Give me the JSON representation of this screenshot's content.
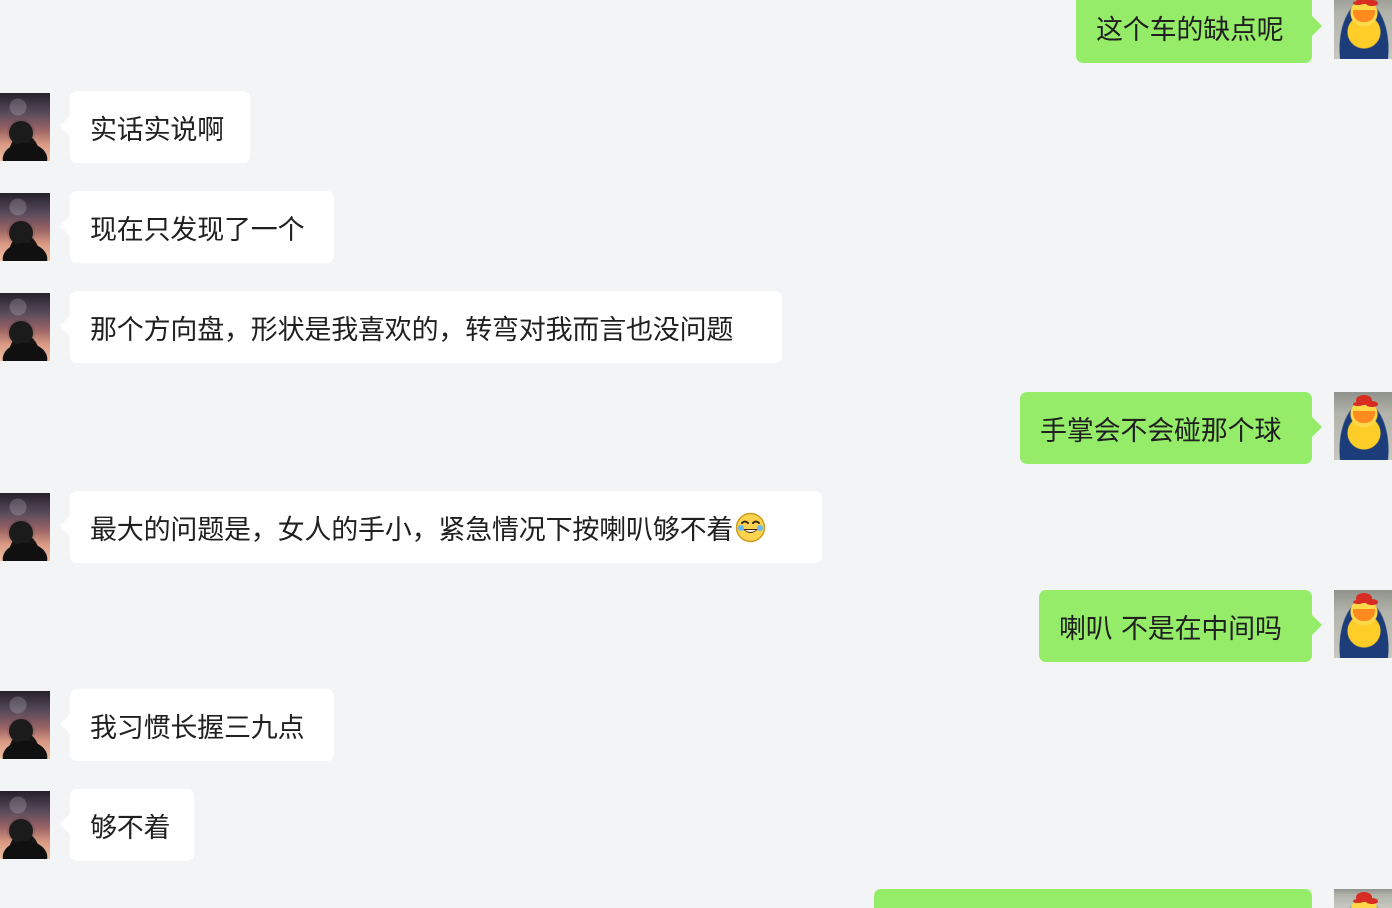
{
  "messages": [
    {
      "side": "right",
      "text": "这个车的缺点呢"
    },
    {
      "side": "left",
      "text": "实话实说啊"
    },
    {
      "side": "left",
      "text": "现在只发现了一个"
    },
    {
      "side": "left",
      "text": "那个方向盘，形状是我喜欢的，转弯对我而言也没问题"
    },
    {
      "side": "right",
      "text": "手掌会不会碰那个球"
    },
    {
      "side": "left",
      "text": "最大的问题是，女人的手小，紧急情况下按喇叭够不着",
      "icon": "laughing-tears-emoji-icon"
    },
    {
      "side": "right",
      "text": "喇叭 不是在中间吗"
    },
    {
      "side": "left",
      "text": "我习惯长握三九点"
    },
    {
      "side": "left",
      "text": "够不着"
    }
  ],
  "colors": {
    "background": "#f3f4f6",
    "incoming_bubble": "#ffffff",
    "outgoing_bubble": "#95ec69",
    "text": "#202020"
  }
}
